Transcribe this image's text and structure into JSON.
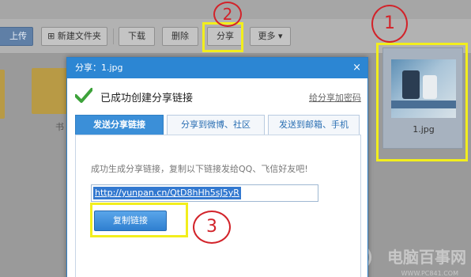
{
  "toolbar": {
    "upload_label": "上传",
    "new_folder_label": "新建文件夹",
    "download_label": "下载",
    "delete_label": "删除",
    "share_label": "分享",
    "more_label": "更多"
  },
  "files": {
    "folder_label": "书",
    "image_label": "1.jpg"
  },
  "dialog": {
    "title": "分享：1.jpg",
    "close": "×",
    "success_text": "已成功创建分享链接",
    "add_password": "给分享加密码",
    "tabs": [
      "发送分享链接",
      "分享到微博、社区",
      "发送到邮箱、手机"
    ],
    "hint": "成功生成分享链接，复制以下链接发给QQ、飞信好友吧!",
    "link_value": "http://yunpan.cn/QtD8hHh5sJ5yR",
    "copy_button": "复制链接"
  },
  "annotations": {
    "step1": "1",
    "step2": "2",
    "step3": "3",
    "highlight_color": "#f2ee1d",
    "circle_color": "#d2232a"
  },
  "watermark": {
    "main": "电脑百事网",
    "sub": "WWW.PC841.COM"
  }
}
